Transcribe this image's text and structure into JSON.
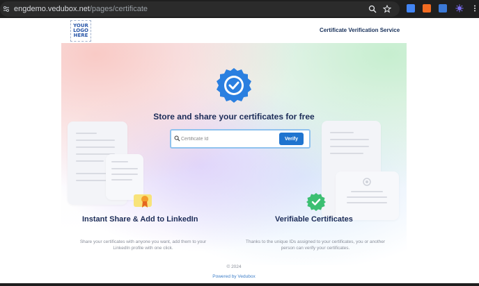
{
  "browser": {
    "url_host": "engdemo.vedubox.net",
    "url_path": "/pages/certificate",
    "icons": [
      "tune-icon",
      "zoom-icon",
      "star-icon",
      "extension-icons"
    ]
  },
  "header": {
    "logo_lines": [
      "YOUR",
      "LOGO",
      "HERE"
    ],
    "service_title": "Certificate Verification Service"
  },
  "hero": {
    "title": "Store and share your certificates for free",
    "search": {
      "placeholder": "Certificate Id",
      "value": "",
      "button_label": "Verify"
    }
  },
  "features": [
    {
      "title": "Instant Share & Add to LinkedIn",
      "desc_lines": [
        "Share your certificates with anyone you want, add them to your",
        "LinkedIn profile with one click."
      ]
    },
    {
      "title": "Verifiable Certificates",
      "desc_lines": [
        "Thanks to the unique IDs assigned to your certificates, you or another",
        "person can verify your certificates."
      ]
    }
  ],
  "footer": {
    "copyright": "© 2024",
    "powered": "Powered by Vedubox"
  },
  "colors": {
    "accent": "#1f74cf",
    "title": "#1b2b57",
    "badge_blue": "#2a7fe0",
    "badge_green": "#3cbf72"
  }
}
